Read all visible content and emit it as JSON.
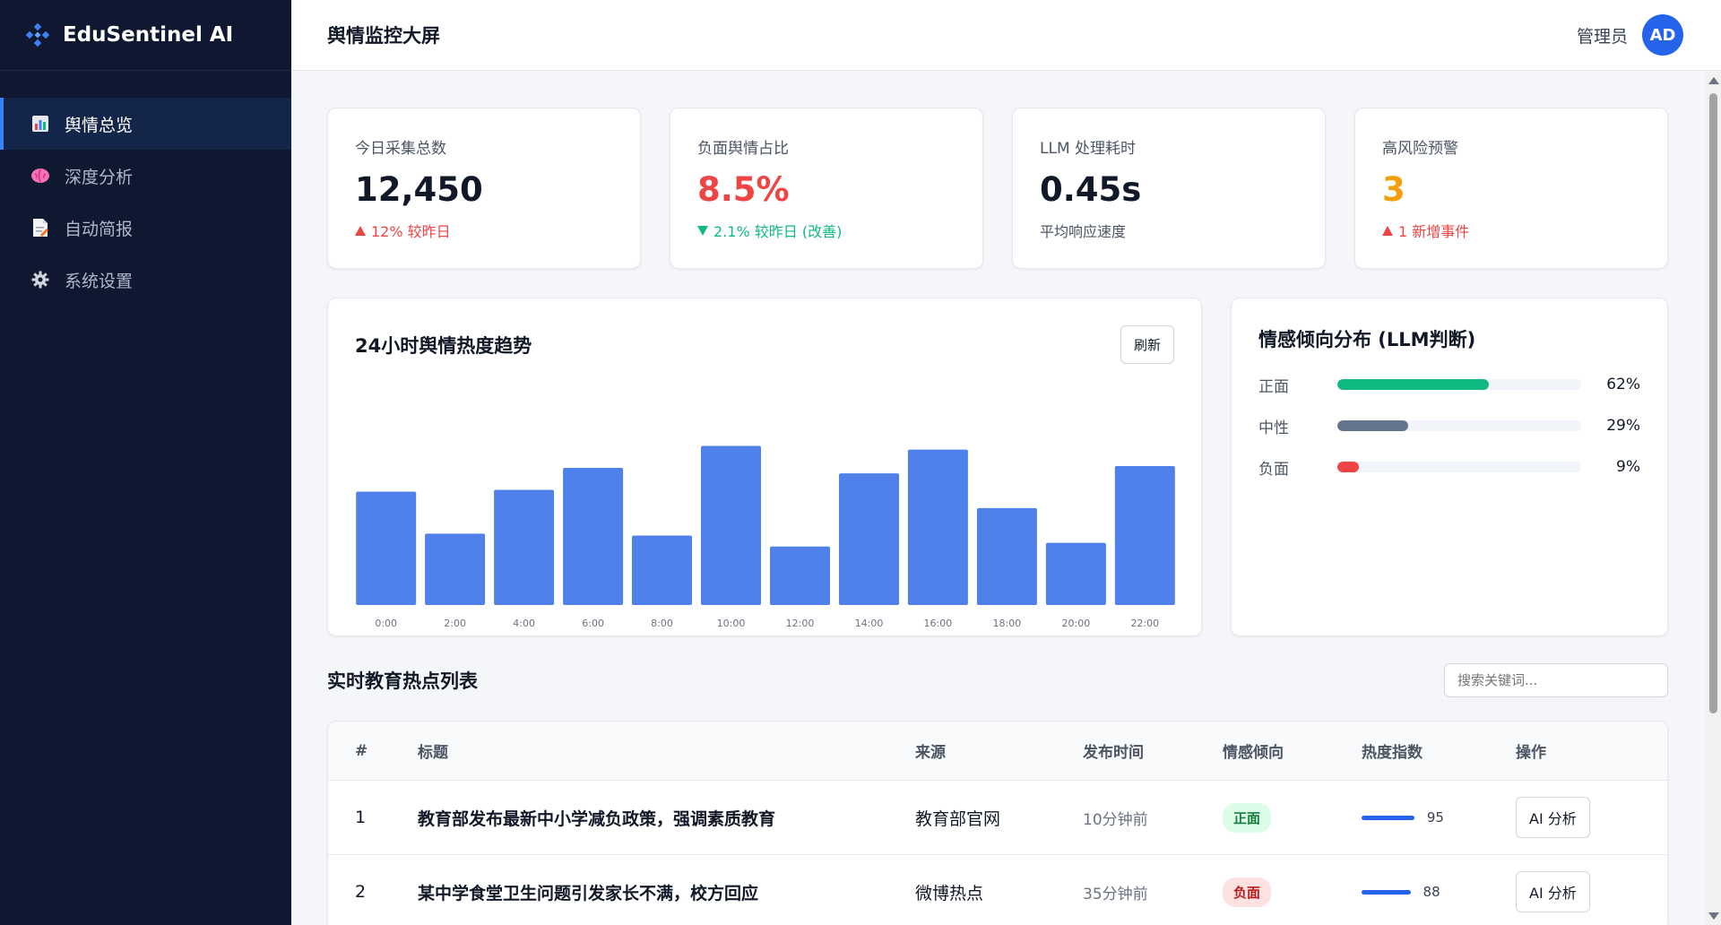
{
  "brand": {
    "name": "EduSentinel AI"
  },
  "sidebar": {
    "items": [
      {
        "label": "舆情总览",
        "icon": "bar-chart-icon",
        "active": true
      },
      {
        "label": "深度分析",
        "icon": "brain-icon",
        "active": false
      },
      {
        "label": "自动简报",
        "icon": "document-icon",
        "active": false
      },
      {
        "label": "系统设置",
        "icon": "gear-icon",
        "active": false
      }
    ]
  },
  "header": {
    "title": "舆情监控大屏",
    "user_name": "管理员",
    "avatar_initials": "AD"
  },
  "stats": [
    {
      "label": "今日采集总数",
      "value": "12,450",
      "sub": "12% 较昨日",
      "trend": "up",
      "color": "#111827"
    },
    {
      "label": "负面舆情占比",
      "value": "8.5%",
      "sub": "2.1% 较昨日 (改善)",
      "trend": "down",
      "color": "#ef4444"
    },
    {
      "label": "LLM 处理耗时",
      "value": "0.45s",
      "sub": "平均响应速度",
      "trend": "none",
      "color": "#111827"
    },
    {
      "label": "高风险预警",
      "value": "3",
      "sub": "1 新增事件",
      "trend": "up",
      "color": "#f59e0b"
    }
  ],
  "trend_chart": {
    "title": "24小时舆情热度趋势",
    "refresh_label": "刷新"
  },
  "chart_data": {
    "type": "bar",
    "title": "24小时舆情热度趋势",
    "categories": [
      "0:00",
      "2:00",
      "4:00",
      "6:00",
      "8:00",
      "10:00",
      "12:00",
      "14:00",
      "16:00",
      "18:00",
      "20:00",
      "22:00"
    ],
    "values": [
      62,
      39,
      63,
      75,
      38,
      87,
      32,
      72,
      85,
      53,
      34,
      76
    ],
    "ylim": [
      0,
      100
    ],
    "color": "#5081ea",
    "grid": false,
    "xlabel": "",
    "ylabel": ""
  },
  "sentiment": {
    "title": "情感倾向分布 (LLM判断)",
    "items": [
      {
        "label": "正面",
        "percent": 62,
        "display": "62%",
        "color": "#10b981"
      },
      {
        "label": "中性",
        "percent": 29,
        "display": "29%",
        "color": "#64748b"
      },
      {
        "label": "负面",
        "percent": 9,
        "display": "9%",
        "color": "#ef4444"
      }
    ]
  },
  "hotlist": {
    "title": "实时教育热点列表",
    "search_placeholder": "搜索关键词...",
    "columns": [
      "#",
      "标题",
      "来源",
      "发布时间",
      "情感倾向",
      "热度指数",
      "操作"
    ],
    "rows": [
      {
        "index": "1",
        "title": "教育部发布最新中小学减负政策，强调素质教育",
        "source": "教育部官网",
        "time": "10分钟前",
        "sentiment": "正面",
        "sentiment_type": "pos",
        "heat": 95,
        "action": "AI 分析"
      },
      {
        "index": "2",
        "title": "某中学食堂卫生问题引发家长不满，校方回应",
        "source": "微博热点",
        "time": "35分钟前",
        "sentiment": "负面",
        "sentiment_type": "neg",
        "heat": 88,
        "action": "AI 分析"
      }
    ]
  }
}
